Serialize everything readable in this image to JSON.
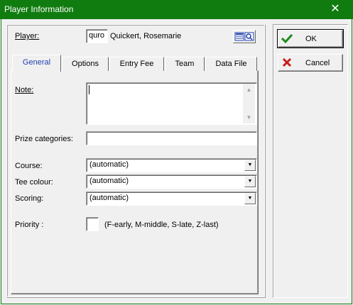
{
  "window": {
    "title": "Player Information",
    "close_glyph": "✕"
  },
  "player": {
    "label": "Player:",
    "code": "quro",
    "name": "Quickert, Rosemarie",
    "lookup_icon": "search-list-icon"
  },
  "tabs": [
    {
      "label": "General",
      "active": true
    },
    {
      "label": "Options",
      "active": false
    },
    {
      "label": "Entry Fee",
      "active": false
    },
    {
      "label": "Team",
      "active": false
    },
    {
      "label": "Data File",
      "active": false
    }
  ],
  "general": {
    "note": {
      "label": "Note:",
      "value": ""
    },
    "prize_categories": {
      "label": "Prize categories:",
      "value": ""
    },
    "course": {
      "label": "Course:",
      "value": "(automatic)"
    },
    "tee_colour": {
      "label": "Tee colour:",
      "value": "(automatic)"
    },
    "scoring": {
      "label": "Scoring:",
      "value": "(automatic)"
    },
    "priority": {
      "label": "Priority :",
      "value": "",
      "hint": "(F-early, M-middle, S-late, Z-last)"
    }
  },
  "buttons": {
    "ok": {
      "label": "OK",
      "icon": "checkmark-icon",
      "color": "#1a8a1a"
    },
    "cancel": {
      "label": "Cancel",
      "icon": "cross-icon",
      "color": "#cc1a1a"
    }
  },
  "colors": {
    "titlebar": "#107c10",
    "active_tab_text": "#1f3fae"
  }
}
